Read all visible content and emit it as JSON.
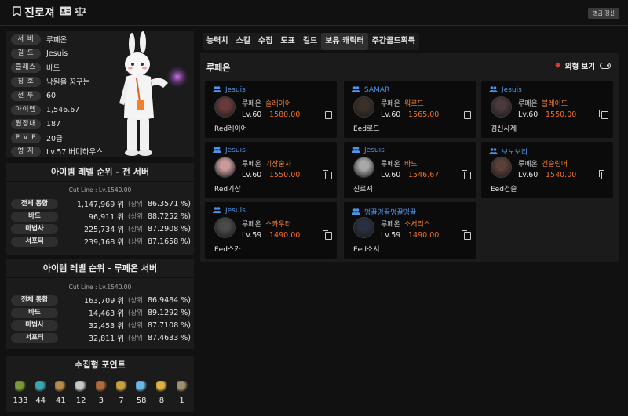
{
  "header": {
    "title": "진로져",
    "refresh_label": "병금 갱신"
  },
  "profile": {
    "rows": [
      {
        "label": "서 버",
        "value": "루페온"
      },
      {
        "label": "길 드",
        "value": "Jesuis"
      },
      {
        "label": "클래스",
        "value": "바드"
      },
      {
        "label": "칭 호",
        "value": "낙원을 꿈꾸는"
      },
      {
        "label": "전 투",
        "value": "60"
      },
      {
        "label": "아이템",
        "value": "1,546.67"
      },
      {
        "label": "원정대",
        "value": "187"
      },
      {
        "label": "P V P",
        "value": "20급"
      },
      {
        "label": "영 지",
        "value": "Lv.57 버미하우스"
      }
    ]
  },
  "rank_all": {
    "title": "아이템 레벨 순위 - 전 서버",
    "cutline": "Cut Line : Lv.1540.00",
    "rows": [
      {
        "label": "전체 통합",
        "rank": "1,147,969 위",
        "prefix": "(상위",
        "pct": "86.3571 %)"
      },
      {
        "label": "바드",
        "rank": "96,911 위",
        "prefix": "(상위",
        "pct": "88.7252 %)"
      },
      {
        "label": "마법사",
        "rank": "225,734 위",
        "prefix": "(상위",
        "pct": "87.2908 %)"
      },
      {
        "label": "서포터",
        "rank": "239,168 위",
        "prefix": "(상위",
        "pct": "87.1658 %)"
      }
    ]
  },
  "rank_server": {
    "title": "아이템 레벨 순위 - 루페온 서버",
    "cutline": "Cut Line : Lv.1540.00",
    "rows": [
      {
        "label": "전체 통합",
        "rank": "163,709 위",
        "prefix": "(상위",
        "pct": "86.9484 %)"
      },
      {
        "label": "바드",
        "rank": "14,463 위",
        "prefix": "(상위",
        "pct": "89.1292 %)"
      },
      {
        "label": "마법사",
        "rank": "32,453 위",
        "prefix": "(상위",
        "pct": "87.7108 %)"
      },
      {
        "label": "서포터",
        "rank": "32,811 위",
        "prefix": "(상위",
        "pct": "87.4633 %)"
      }
    ]
  },
  "collect": {
    "title": "수집형 포인트",
    "items": [
      {
        "icon": "island-heart-icon",
        "value": "133",
        "color": "#7a9a3a"
      },
      {
        "icon": "orpheus-star-icon",
        "value": "44",
        "color": "#3aa8b0"
      },
      {
        "icon": "giant-heart-icon",
        "value": "41",
        "color": "#b88a4a"
      },
      {
        "icon": "art-icon",
        "value": "12",
        "color": "#c8c8c8"
      },
      {
        "icon": "adventure-icon",
        "value": "3",
        "color": "#b06a3a"
      },
      {
        "icon": "ignea-icon",
        "value": "7",
        "color": "#c8a040"
      },
      {
        "icon": "world-tree-leaf-icon",
        "value": "58",
        "color": "#6ab8e8"
      },
      {
        "icon": "mococo-seed-icon",
        "value": "8",
        "color": "#e0b040"
      },
      {
        "icon": "sea-bounty-icon",
        "value": "1",
        "color": "#a09070"
      }
    ]
  },
  "tabs": [
    "능력치",
    "스킬",
    "수집",
    "도표",
    "길드",
    "보유 캐릭터",
    "주간골드획득"
  ],
  "active_tab": "보유 캐릭터",
  "panel": {
    "title": "루페온",
    "outfit_label": "외형 보기"
  },
  "characters": [
    {
      "guild": "Jesuis",
      "server": "루페온",
      "class": "슬레이어",
      "level": "Lv.60",
      "item_level": "1580.00",
      "name": "Red레이어",
      "avatar_color": "#6a3a3a"
    },
    {
      "guild": "SAMAR",
      "server": "루페온",
      "class": "워로드",
      "level": "Lv.60",
      "item_level": "1565.00",
      "name": "Eed로드",
      "avatar_color": "#3a3028"
    },
    {
      "guild": "Jesuis",
      "server": "루페온",
      "class": "블레이드",
      "level": "Lv.60",
      "item_level": "1550.00",
      "name": "검신사제",
      "avatar_color": "#4a3a3a"
    },
    {
      "guild": "Jesuis",
      "server": "루페온",
      "class": "기상술사",
      "level": "Lv.60",
      "item_level": "1550.00",
      "name": "Red기상",
      "avatar_color": "#c89a9a"
    },
    {
      "guild": "Jesuis",
      "server": "루페온",
      "class": "바드",
      "level": "Lv.60",
      "item_level": "1546.67",
      "name": "진로져",
      "avatar_color": "#a8a8a8"
    },
    {
      "guild": "보노보리",
      "server": "루페온",
      "class": "건슬링어",
      "level": "Lv.60",
      "item_level": "1540.00",
      "name": "Eed건슬",
      "avatar_color": "#5a4038"
    },
    {
      "guild": "Jesuis",
      "server": "루페온",
      "class": "스카우터",
      "level": "Lv.59",
      "item_level": "1490.00",
      "name": "Eed스카",
      "avatar_color": "#4a4a4a"
    },
    {
      "guild": "멍꿀멍꿀멍꿀멍꿀",
      "server": "루페온",
      "class": "소서리스",
      "level": "Lv.59",
      "item_level": "1490.00",
      "name": "Eed소서",
      "avatar_color": "#2a3040"
    }
  ]
}
